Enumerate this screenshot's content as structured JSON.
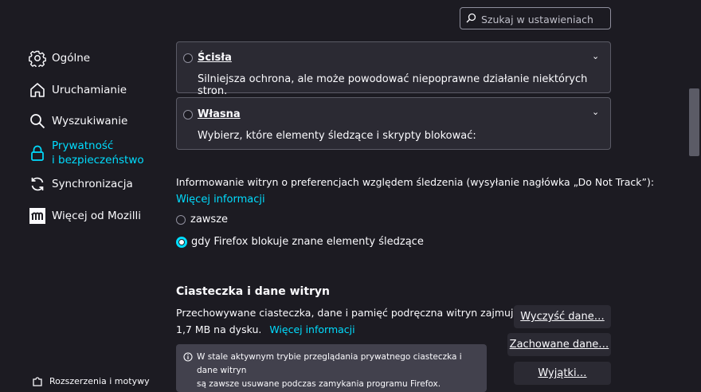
{
  "search": {
    "placeholder": "Szukaj w ustawieniach"
  },
  "sidebar": {
    "items": [
      {
        "label": "Ogólne",
        "icon": "gear-icon"
      },
      {
        "label": "Uruchamianie",
        "icon": "home-icon"
      },
      {
        "label": "Wyszukiwanie",
        "icon": "search-icon"
      },
      {
        "label_line1": "Prywatność",
        "label_line2": "i bezpieczeństwo",
        "icon": "lock-icon",
        "active": true
      },
      {
        "label": "Synchronizacja",
        "icon": "sync-icon"
      },
      {
        "label": "Więcej od Mozilli",
        "icon": "mozilla-icon"
      }
    ],
    "bottom": {
      "label": "Rozszerzenia i motywy",
      "icon": "puzzle-icon"
    }
  },
  "tracking": {
    "strict": {
      "title": "Ścisła",
      "description": "Silniejsza ochrona, ale może powodować niepoprawne działanie niektórych stron."
    },
    "custom": {
      "title": "Własna",
      "description": "Wybierz, które elementy śledzące i skrypty blokować:"
    }
  },
  "dnt": {
    "label": "Informowanie witryn o preferencjach względem śledzenia (wysyłanie nagłówka „Do Not Track”):",
    "more_info": "Więcej informacji",
    "options": [
      {
        "label": "zawsze",
        "checked": false
      },
      {
        "label": "gdy Firefox blokuje znane elementy śledzące",
        "checked": true
      }
    ]
  },
  "cookies": {
    "heading": "Ciasteczka i dane witryn",
    "description_line1": "Przechowywane ciasteczka, dane i pamięć podręczna witryn zajmują",
    "description_line2": "1,7 MB na dysku.",
    "more_info": "Więcej informacji",
    "buttons": {
      "clear": "Wyczyść dane…",
      "saved": "Zachowane dane…",
      "exceptions": "Wyjątki…"
    },
    "note_line1": "W stale aktywnym trybie przeglądania prywatnego ciasteczka i dane witryn",
    "note_line2": "są zawsze usuwane podczas zamykania programu Firefox."
  },
  "colors": {
    "accent": "#00ddff",
    "background": "#1c1b22",
    "card": "#2b2a33"
  }
}
